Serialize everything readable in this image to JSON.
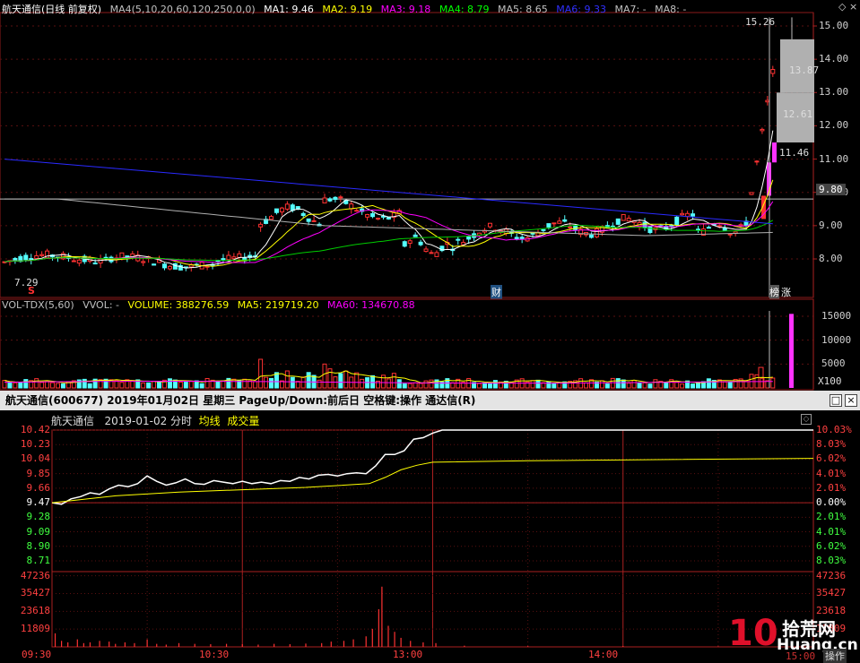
{
  "kline": {
    "title": "航天通信(日线 前复权)",
    "ma_params": "MA4(5,10,20,60,120,250,0,0)",
    "ma": [
      {
        "label": "MA1: 9.46",
        "color": "#ffffff"
      },
      {
        "label": "MA2: 9.19",
        "color": "#ffff00"
      },
      {
        "label": "MA3: 9.18",
        "color": "#ff00ff"
      },
      {
        "label": "MA4: 8.79",
        "color": "#00ff00"
      },
      {
        "label": "MA5: 8.65",
        "color": "#c0c0c0"
      },
      {
        "label": "MA6: 9.33",
        "color": "#3030ff"
      },
      {
        "label": "MA7: -",
        "color": "#c0c0c0"
      },
      {
        "label": "MA8: -",
        "color": "#c0c0c0"
      }
    ],
    "y_ticks": [
      "15.00",
      "14.00",
      "13.00",
      "12.00",
      "11.00",
      "10.00",
      "9.00",
      "8.00"
    ],
    "current_price_tag": "9.80",
    "high_label": "15.26",
    "low_label": "7.29",
    "annotations": [
      "13.87",
      "12.61",
      "11.46"
    ],
    "markers": {
      "s": "S",
      "cai": "财",
      "bang": "榜",
      "zhang": "涨"
    }
  },
  "volume": {
    "title": "VOL-TDX(5,60)",
    "vvol": "VVOL: -",
    "volume": "VOLUME: 388276.59",
    "ma5": "MA5: 219719.20",
    "ma60": "MA60: 134670.88",
    "y_ticks": [
      "15000",
      "10000",
      "5000"
    ],
    "unit": "X100"
  },
  "info_bar": {
    "text": "航天通信(600677)  2019年01月02日 星期三  PageUp/Down:前后日  空格键:操作  通达信(R)"
  },
  "intraday": {
    "stock": "航天通信",
    "date_label": "2019-01-02 分时",
    "avg_label": "均线",
    "vol_label": "成交量",
    "price_ticks": [
      "10.42",
      "10.23",
      "10.04",
      "9.85",
      "9.66",
      "9.47",
      "9.28",
      "9.09",
      "8.90",
      "8.71"
    ],
    "pct_ticks": [
      "10.03%",
      "8.03%",
      "6.02%",
      "4.01%",
      "2.01%",
      "0.00%",
      "2.01%",
      "4.01%",
      "6.02%",
      "8.03%"
    ],
    "vol_ticks": [
      "47236",
      "35427",
      "23618",
      "11809"
    ],
    "time_ticks": [
      "09:30",
      "10:30",
      "13:00",
      "14:00"
    ],
    "price_points": [
      [
        0,
        9.47
      ],
      [
        3,
        9.45
      ],
      [
        6,
        9.52
      ],
      [
        9,
        9.55
      ],
      [
        12,
        9.6
      ],
      [
        15,
        9.58
      ],
      [
        18,
        9.65
      ],
      [
        21,
        9.7
      ],
      [
        24,
        9.68
      ],
      [
        27,
        9.72
      ],
      [
        30,
        9.82
      ],
      [
        33,
        9.75
      ],
      [
        36,
        9.7
      ],
      [
        39,
        9.73
      ],
      [
        42,
        9.78
      ],
      [
        45,
        9.72
      ],
      [
        48,
        9.71
      ],
      [
        51,
        9.76
      ],
      [
        54,
        9.74
      ],
      [
        57,
        9.72
      ],
      [
        60,
        9.75
      ],
      [
        63,
        9.72
      ],
      [
        66,
        9.74
      ],
      [
        69,
        9.72
      ],
      [
        72,
        9.76
      ],
      [
        75,
        9.75
      ],
      [
        78,
        9.8
      ],
      [
        81,
        9.78
      ],
      [
        84,
        9.83
      ],
      [
        87,
        9.84
      ],
      [
        90,
        9.82
      ],
      [
        93,
        9.85
      ],
      [
        96,
        9.86
      ],
      [
        99,
        9.85
      ],
      [
        102,
        9.95
      ],
      [
        105,
        10.1
      ],
      [
        108,
        10.1
      ],
      [
        111,
        10.15
      ],
      [
        114,
        10.3
      ],
      [
        117,
        10.32
      ],
      [
        120,
        10.38
      ],
      [
        123,
        10.42
      ],
      [
        240,
        10.42
      ]
    ],
    "avg_points": [
      [
        0,
        9.47
      ],
      [
        20,
        9.56
      ],
      [
        40,
        9.61
      ],
      [
        60,
        9.64
      ],
      [
        80,
        9.67
      ],
      [
        100,
        9.72
      ],
      [
        105,
        9.8
      ],
      [
        110,
        9.9
      ],
      [
        115,
        9.96
      ],
      [
        120,
        10.0
      ],
      [
        150,
        10.02
      ],
      [
        240,
        10.05
      ]
    ],
    "vol_bars": [
      [
        1,
        9000
      ],
      [
        3,
        4000
      ],
      [
        5,
        3000
      ],
      [
        8,
        5000
      ],
      [
        10,
        2500
      ],
      [
        12,
        3000
      ],
      [
        15,
        4000
      ],
      [
        18,
        3500
      ],
      [
        20,
        2000
      ],
      [
        23,
        3000
      ],
      [
        26,
        2500
      ],
      [
        30,
        5000
      ],
      [
        33,
        2000
      ],
      [
        36,
        1500
      ],
      [
        40,
        2500
      ],
      [
        45,
        2000
      ],
      [
        50,
        1800
      ],
      [
        55,
        2000
      ],
      [
        60,
        1800
      ],
      [
        65,
        1500
      ],
      [
        70,
        2000
      ],
      [
        75,
        1800
      ],
      [
        80,
        2200
      ],
      [
        85,
        2500
      ],
      [
        88,
        3500
      ],
      [
        92,
        4000
      ],
      [
        95,
        5000
      ],
      [
        99,
        7000
      ],
      [
        101,
        12000
      ],
      [
        103,
        25000
      ],
      [
        104,
        40000
      ],
      [
        106,
        14000
      ],
      [
        108,
        10000
      ],
      [
        110,
        6000
      ],
      [
        113,
        4000
      ],
      [
        117,
        3000
      ],
      [
        121,
        2500
      ],
      [
        130,
        800
      ],
      [
        150,
        500
      ],
      [
        180,
        600
      ],
      [
        210,
        400
      ],
      [
        235,
        400
      ]
    ]
  },
  "watermark": {
    "line1": "拾荒网",
    "line2": "Huang.cn",
    "num": "10",
    "op": "操作",
    "time": "15:00"
  }
}
